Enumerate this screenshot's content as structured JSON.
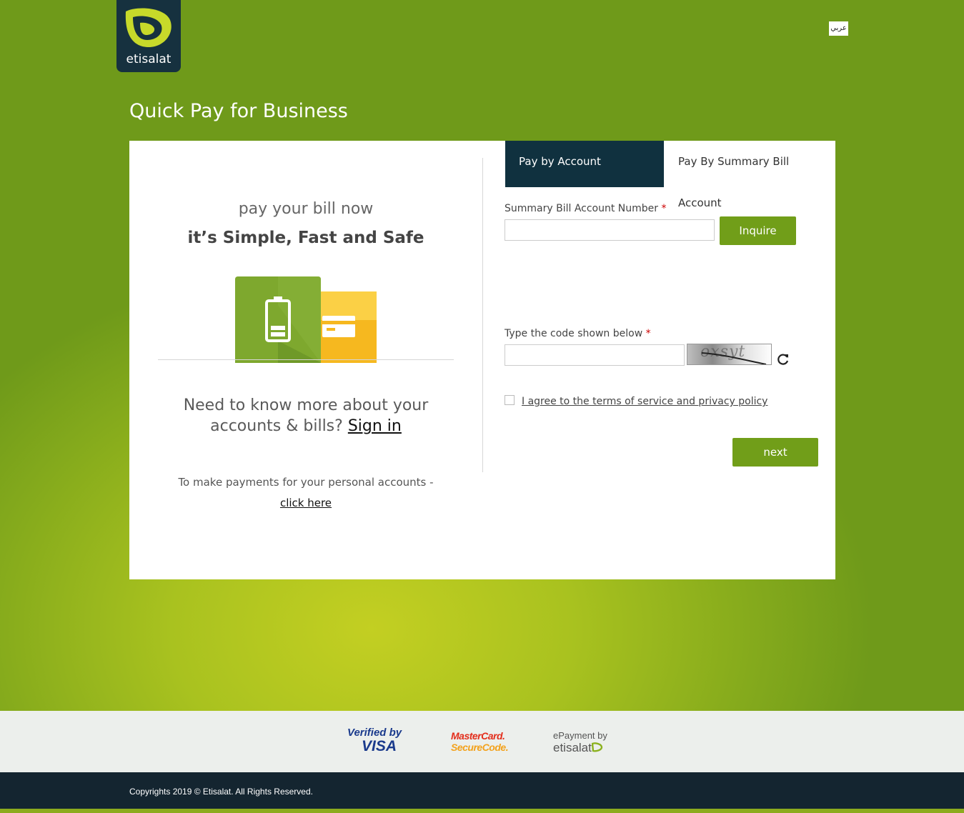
{
  "brand": {
    "logo_text": "etisalat"
  },
  "language_toggle": "عربي",
  "page_title": "Quick Pay for Business",
  "left_panel": {
    "line1": "pay your bill now",
    "line2": "it’s Simple, Fast and Safe",
    "more_info": "Need to know more about your accounts & bills?",
    "sign_in_link": "Sign in",
    "personal_text": "To make payments for your personal accounts -",
    "click_here_link": "click here"
  },
  "tabs": [
    {
      "label": "Pay by Account",
      "active": true
    },
    {
      "label": "Pay By Summary Bill Account",
      "active": false
    }
  ],
  "form": {
    "account_label": "Summary Bill Account Number",
    "account_value": "",
    "inquire_button": "Inquire",
    "code_label": "Type the code shown below",
    "code_value": "",
    "captcha_text": "oxsyt",
    "terms_text": "I agree to the terms of service and privacy policy",
    "terms_checked": false,
    "next_button": "next",
    "required_mark": "*"
  },
  "footer": {
    "visa_line1": "Verified by",
    "visa_line2": "VISA",
    "mastercard_line1": "MasterCard.",
    "mastercard_line2": "SecureCode.",
    "epay_line1": "ePayment by",
    "epay_line2": "etisalat",
    "copyright": "Copyrights 2019 © Etisalat. All Rights Reserved."
  },
  "colors": {
    "brand_green": "#719e19",
    "dark_navy": "#10313f",
    "footer_navy": "#142530"
  }
}
